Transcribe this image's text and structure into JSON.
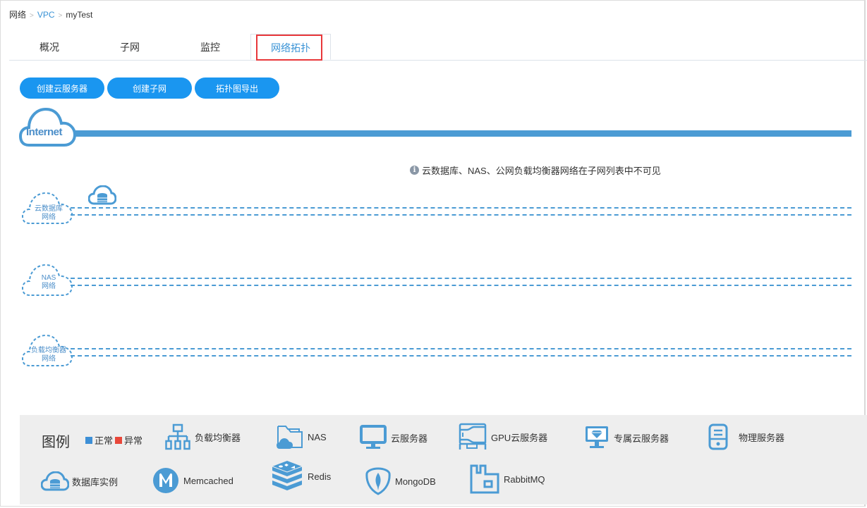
{
  "breadcrumb": {
    "items": [
      "网络",
      "VPC",
      "myTest"
    ],
    "separator": ">"
  },
  "tabs": [
    {
      "label": "概况",
      "active": false
    },
    {
      "label": "子网",
      "active": false
    },
    {
      "label": "监控",
      "active": false
    },
    {
      "label": "网络拓扑",
      "active": true
    }
  ],
  "toolbar": {
    "create_server": "创建云服务器",
    "create_subnet": "创建子网",
    "export_topology": "拓扑图导出"
  },
  "topology": {
    "internet_label": "Internet",
    "notice": "云数据库、NAS、公网负载均衡器网络在子网列表中不可见",
    "networks": [
      {
        "line1": "云数据库",
        "line2": "网络",
        "has_db_icon": true
      },
      {
        "line1": "NAS",
        "line2": "网络"
      },
      {
        "line1": "负载均衡器",
        "line2": "网络"
      }
    ]
  },
  "legend": {
    "title": "图例",
    "status": [
      {
        "label": "正常",
        "color": "#3d8fd6"
      },
      {
        "label": "异常",
        "color": "#e8473a"
      }
    ],
    "items": [
      {
        "label": "负载均衡器",
        "icon": "load-balancer-icon"
      },
      {
        "label": "NAS",
        "icon": "nas-folder-icon"
      },
      {
        "label": "云服务器",
        "icon": "monitor-icon"
      },
      {
        "label": "GPU云服务器",
        "icon": "gpu-server-icon"
      },
      {
        "label": "专属云服务器",
        "icon": "dedicated-server-icon"
      },
      {
        "label": "物理服务器",
        "icon": "physical-server-icon"
      },
      {
        "label": "数据库实例",
        "icon": "cloud-database-icon"
      },
      {
        "label": "Memcached",
        "icon": "memcached-icon"
      },
      {
        "label": "Redis",
        "icon": "redis-icon"
      },
      {
        "label": "MongoDB",
        "icon": "mongodb-icon"
      },
      {
        "label": "RabbitMQ",
        "icon": "rabbitmq-icon"
      }
    ]
  },
  "colors": {
    "accent": "#1a96f0",
    "line": "#4b9bd4",
    "highlight": "#e8373a"
  }
}
